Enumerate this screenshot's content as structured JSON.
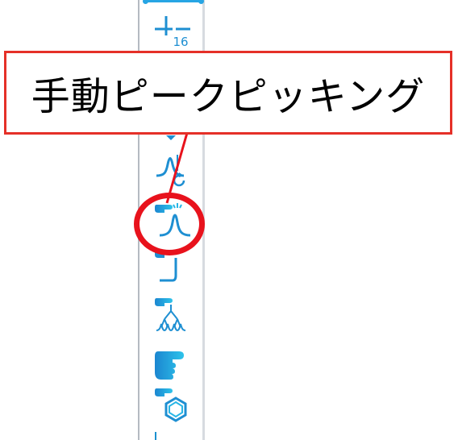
{
  "callout": {
    "label": "手動ピークピッキング"
  },
  "colors": {
    "icon_blue": "#1e8fd2",
    "icon_cyan": "#27b6e6",
    "callout_border": "#e53028",
    "highlight_ring": "#e8121c"
  },
  "toolbar": {
    "tools": [
      {
        "name": "integral-cursor-icon",
        "badge": "16"
      },
      {
        "name": "phase-tool-icon"
      },
      {
        "name": "peak-integration-icon"
      },
      {
        "name": "manual-peak-picking-icon"
      },
      {
        "name": "baseline-correction-icon"
      },
      {
        "name": "multiplet-analysis-icon"
      },
      {
        "name": "pointer-hand-icon"
      },
      {
        "name": "structure-assignment-icon"
      }
    ]
  }
}
